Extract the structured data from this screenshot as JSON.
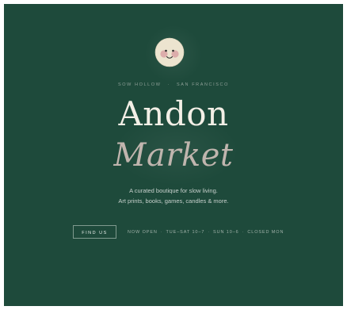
{
  "hero": {
    "location_left": "SOW HOLLOW",
    "location_sep": "·",
    "location_right": "SAN FRANCISCO",
    "title_line1": "Andon",
    "title_line2": "Market",
    "tagline_line1": "A curated boutique for slow living.",
    "tagline_line2": "Art prints, books, games, candles & more.",
    "cta_label": "FIND US"
  },
  "hours": {
    "items": [
      "NOW OPEN",
      "TUE–SAT 10–7",
      "SUN 10–6",
      "CLOSED MON"
    ],
    "separator": "·"
  },
  "theme": {
    "background": "#1e4a3b",
    "title_color": "#f3efe6",
    "title_italic_color": "#c0b5ae",
    "logo_face": "#ece4cf",
    "cheek": "#d9a3a4"
  },
  "icons": {
    "logo": "moon-face-icon"
  }
}
